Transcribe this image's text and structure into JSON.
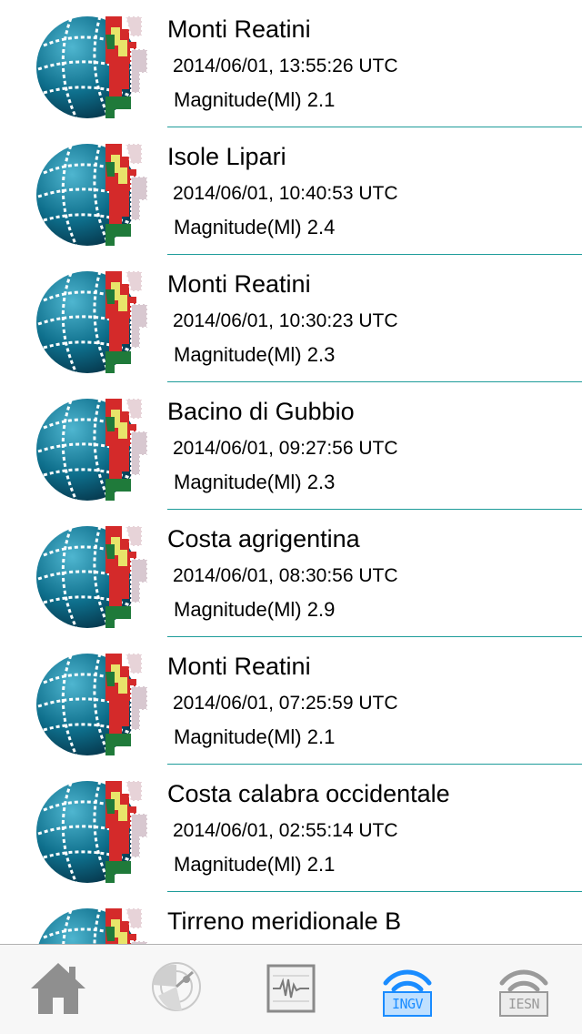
{
  "events": [
    {
      "place": "Monti Reatini",
      "time": "2014/06/01, 13:55:26 UTC",
      "magnitude": "Magnitude(Ml) 2.1"
    },
    {
      "place": "Isole Lipari",
      "time": "2014/06/01, 10:40:53 UTC",
      "magnitude": "Magnitude(Ml) 2.4"
    },
    {
      "place": "Monti Reatini",
      "time": "2014/06/01, 10:30:23 UTC",
      "magnitude": "Magnitude(Ml) 2.3"
    },
    {
      "place": "Bacino di Gubbio",
      "time": "2014/06/01, 09:27:56 UTC",
      "magnitude": "Magnitude(Ml) 2.3"
    },
    {
      "place": "Costa agrigentina",
      "time": "2014/06/01, 08:30:56 UTC",
      "magnitude": "Magnitude(Ml) 2.9"
    },
    {
      "place": "Monti Reatini",
      "time": "2014/06/01, 07:25:59 UTC",
      "magnitude": "Magnitude(Ml) 2.1"
    },
    {
      "place": "Costa calabra occidentale",
      "time": "2014/06/01, 02:55:14 UTC",
      "magnitude": "Magnitude(Ml) 2.1"
    },
    {
      "place": "Tirreno meridionale B",
      "time": "",
      "magnitude": ""
    }
  ],
  "tabs": [
    {
      "name": "home",
      "icon": "home-icon",
      "label": "",
      "selected": false
    },
    {
      "name": "seismic-radar",
      "icon": "radar-icon",
      "label": "",
      "selected": false
    },
    {
      "name": "seismogram",
      "icon": "seismogram-icon",
      "label": "",
      "selected": false
    },
    {
      "name": "ingv",
      "icon": "ingv-feed-icon",
      "label": "INGV",
      "selected": true
    },
    {
      "name": "iesn",
      "icon": "iesn-feed-icon",
      "label": "IESN",
      "selected": false
    }
  ],
  "colors": {
    "divider": "#1e9c9a",
    "tab_active": "#1a8cff",
    "tab_inactive": "#9a9a9a",
    "logo_globe": "#0e6f8c",
    "logo_red": "#d42a2a",
    "logo_yellow": "#e8e46a",
    "logo_green": "#1f7a3a"
  }
}
